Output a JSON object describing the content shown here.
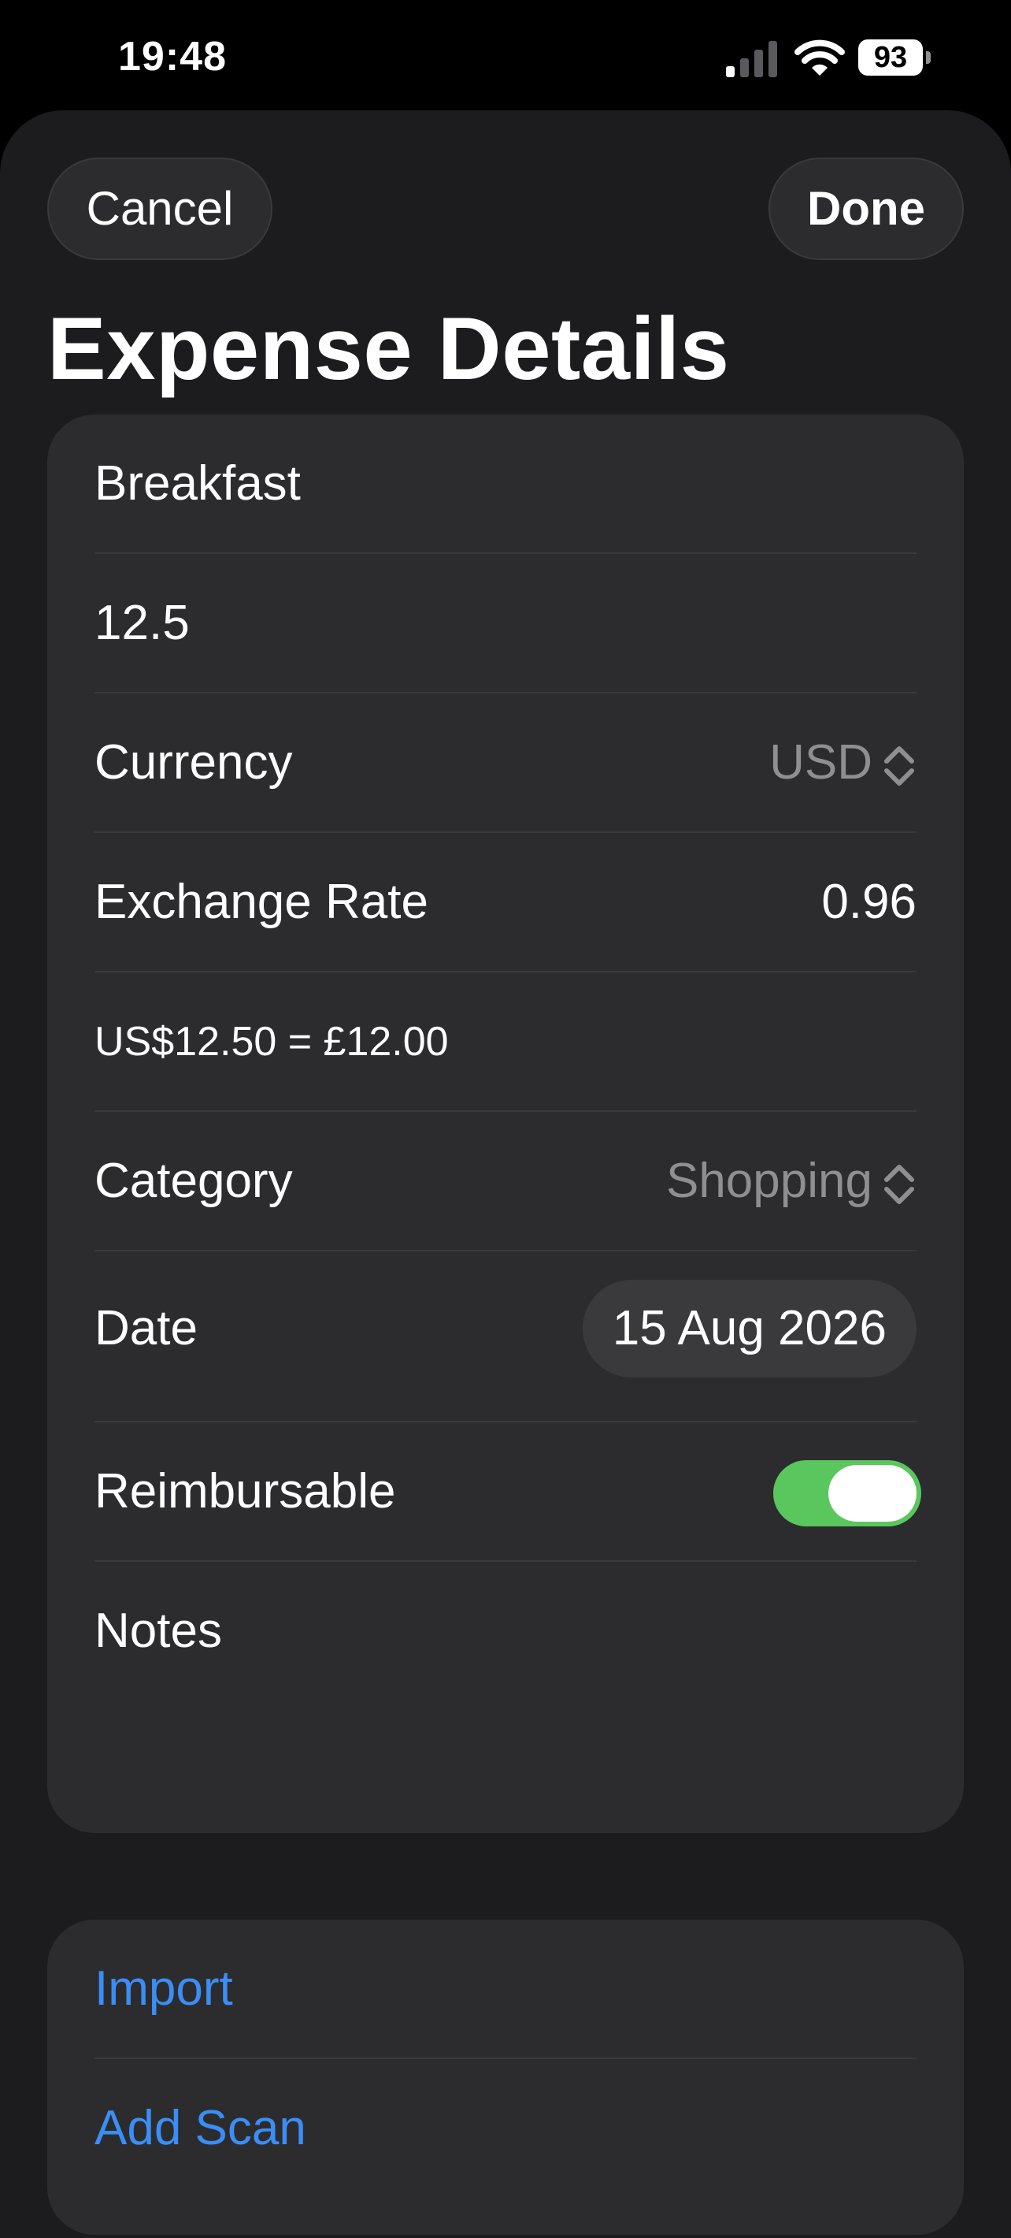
{
  "status_bar": {
    "time": "19:48",
    "battery": "93"
  },
  "header": {
    "cancel_label": "Cancel",
    "done_label": "Done",
    "title": "Expense Details"
  },
  "form": {
    "name_value": "Breakfast",
    "amount_value": "12.5",
    "currency": {
      "label": "Currency",
      "value": "USD"
    },
    "exchange_rate": {
      "label": "Exchange Rate",
      "value": "0.96"
    },
    "conversion_text": "US$12.50 = £12.00",
    "category": {
      "label": "Category",
      "value": "Shopping"
    },
    "date": {
      "label": "Date",
      "value": "15 Aug 2026"
    },
    "reimbursable": {
      "label": "Reimbursable",
      "enabled": true
    },
    "notes_placeholder": "Notes"
  },
  "actions": {
    "import_label": "Import",
    "add_scan_label": "Add Scan"
  },
  "colors": {
    "accent": "#3a8ef6",
    "toggle_on": "#5ac65e",
    "background": "#1c1c1e",
    "card": "#2c2c2e"
  }
}
